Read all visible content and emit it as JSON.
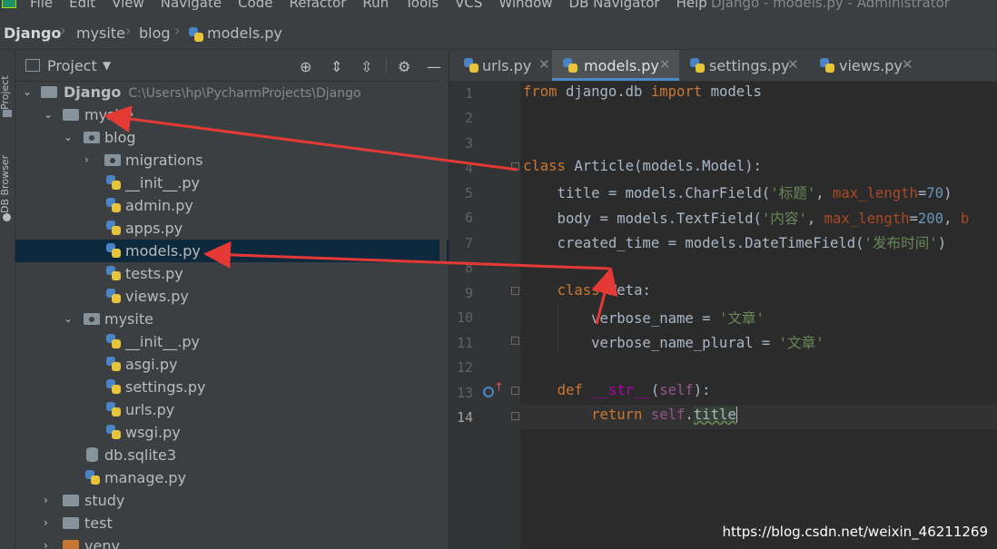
{
  "menu": {
    "items": [
      "File",
      "Edit",
      "View",
      "Navigate",
      "Code",
      "Refactor",
      "Run",
      "Tools",
      "VCS",
      "Window",
      "DB Navigator",
      "Help"
    ],
    "window_title": "Django - models.py - Administrator"
  },
  "breadcrumb": [
    "Django",
    "mysite",
    "blog",
    "models.py"
  ],
  "side_tabs": {
    "project": "Project",
    "db_browser": "DB Browser"
  },
  "project_panel": {
    "title": "Project",
    "tree": [
      {
        "label": "Django",
        "path": "C:\\Users\\hp\\PycharmProjects\\Django",
        "icon": "folder-icon",
        "expanded": true
      },
      {
        "label": "mysite",
        "icon": "folder-icon",
        "expanded": true
      },
      {
        "label": "blog",
        "icon": "package-folder-icon",
        "expanded": true
      },
      {
        "label": "migrations",
        "icon": "package-folder-icon",
        "expanded": false
      },
      {
        "label": "__init__.py",
        "icon": "python-file-icon"
      },
      {
        "label": "admin.py",
        "icon": "python-file-icon"
      },
      {
        "label": "apps.py",
        "icon": "python-file-icon"
      },
      {
        "label": "models.py",
        "icon": "python-file-icon",
        "selected": true
      },
      {
        "label": "tests.py",
        "icon": "python-file-icon"
      },
      {
        "label": "views.py",
        "icon": "python-file-icon"
      },
      {
        "label": "mysite",
        "icon": "package-folder-icon",
        "expanded": true
      },
      {
        "label": "__init__.py",
        "icon": "python-file-icon"
      },
      {
        "label": "asgi.py",
        "icon": "python-file-icon"
      },
      {
        "label": "settings.py",
        "icon": "python-file-icon"
      },
      {
        "label": "urls.py",
        "icon": "python-file-icon"
      },
      {
        "label": "wsgi.py",
        "icon": "python-file-icon"
      },
      {
        "label": "db.sqlite3",
        "icon": "database-file-icon"
      },
      {
        "label": "manage.py",
        "icon": "python-file-icon"
      },
      {
        "label": "study",
        "icon": "folder-icon",
        "expanded": false
      },
      {
        "label": "test",
        "icon": "folder-icon",
        "expanded": false
      },
      {
        "label": "venv",
        "icon": "venv-folder-icon",
        "expanded": false
      }
    ]
  },
  "editor": {
    "tabs": [
      {
        "label": "urls.py",
        "active": false
      },
      {
        "label": "models.py",
        "active": true
      },
      {
        "label": "settings.py",
        "active": false
      },
      {
        "label": "views.py",
        "active": false
      }
    ],
    "line_numbers": [
      "1",
      "2",
      "3",
      "4",
      "5",
      "6",
      "7",
      "8",
      "9",
      "10",
      "11",
      "12",
      "13",
      "14"
    ],
    "current_line": "14",
    "lines": [
      "from django.db import models",
      "",
      "",
      "class Article(models.Model):",
      "    title = models.CharField('标题', max_length=70)",
      "    body = models.TextField('内容', max_length=200, b",
      "    created_time = models.DateTimeField('发布时间')",
      "",
      "    class Meta:",
      "        verbose_name = '文章'",
      "        verbose_name_plural = '文章'",
      "",
      "    def __str__(self):",
      "        return self.title"
    ]
  },
  "watermark": "https://blog.csdn.net/weixin_46211269",
  "colors": {
    "background": "#2b2b2b",
    "panel": "#3c3f41",
    "keyword": "#cc7832",
    "string": "#6a8759",
    "number": "#6897bb",
    "annotation_arrow": "#e53935"
  }
}
